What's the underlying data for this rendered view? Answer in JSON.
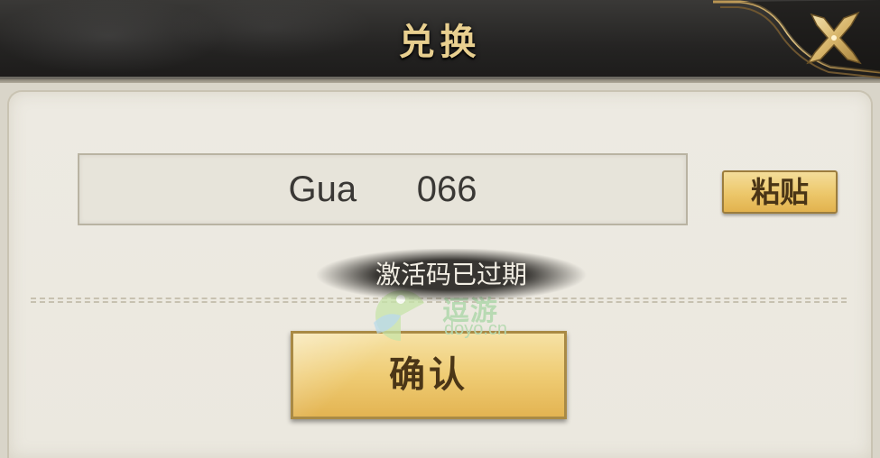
{
  "header": {
    "title": "兑换",
    "close_icon": "close-x-icon"
  },
  "redeem": {
    "code_value": "Gua      066",
    "paste_label": "粘贴",
    "confirm_label": "确认"
  },
  "toast": {
    "message": "激活码已过期"
  },
  "watermark": {
    "name": "逗游",
    "url": "doyo.cn"
  },
  "colors": {
    "title_gold": "#e8cf8f",
    "button_gold": "#ecc76a",
    "panel_bg": "#ebe8df",
    "header_bg": "#252423"
  }
}
